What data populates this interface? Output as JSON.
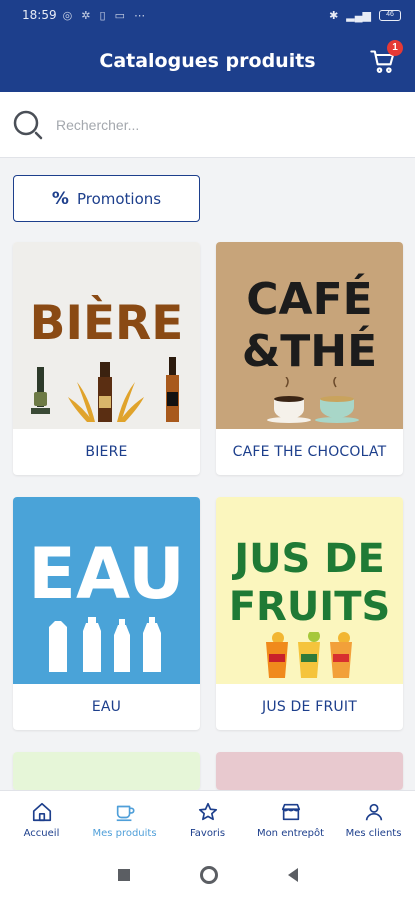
{
  "status_bar": {
    "time": "18:59",
    "battery": "46"
  },
  "header": {
    "title": "Catalogues produits",
    "cart_count": "1"
  },
  "search": {
    "placeholder": "Rechercher..."
  },
  "promotions": {
    "label": "Promotions"
  },
  "categories": [
    {
      "label": "BIERE",
      "image_text": [
        "BIÈRE"
      ]
    },
    {
      "label": "CAFE THE CHOCOLAT",
      "image_text": [
        "CAFÉ",
        "&THÉ"
      ]
    },
    {
      "label": "EAU",
      "image_text": [
        "EAU"
      ]
    },
    {
      "label": "JUS DE FRUIT",
      "image_text": [
        "JUS DE",
        "FRUITS"
      ]
    }
  ],
  "bottom_nav": {
    "items": [
      {
        "label": "Accueil",
        "icon": "home-icon"
      },
      {
        "label": "Mes produits",
        "icon": "cup-icon",
        "active": true
      },
      {
        "label": "Favoris",
        "icon": "star-icon"
      },
      {
        "label": "Mon entrepôt",
        "icon": "store-icon"
      },
      {
        "label": "Mes clients",
        "icon": "person-icon"
      }
    ]
  },
  "colors": {
    "primary": "#1d3f8c",
    "active": "#4f9fd9",
    "badge": "#e53935"
  }
}
